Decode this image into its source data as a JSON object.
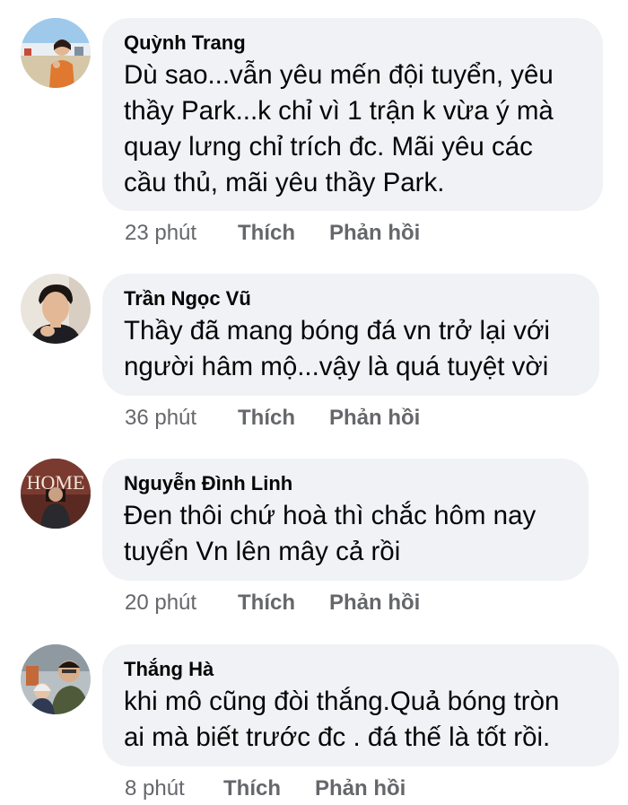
{
  "comments": [
    {
      "author": "Quỳnh Trang",
      "lines": [
        "Dù sao...vẫn yêu mến đội tuyển, yêu",
        "thầy Park...k chỉ vì 1 trận k vừa ý mà",
        "quay lưng chỉ trích đc. Mãi yêu các",
        "cầu thủ, mãi yêu thầy Park."
      ],
      "time": "23 phút",
      "like_label": "Thích",
      "reply_label": "Phản hồi"
    },
    {
      "author": "Trần Ngọc Vũ",
      "lines": [
        "Thầy đã mang bóng đá vn trở lại với",
        "người hâm mộ...vậy là quá tuyệt vời"
      ],
      "time": "36 phút",
      "like_label": "Thích",
      "reply_label": "Phản hồi"
    },
    {
      "author": "Nguyễn Đình Linh",
      "lines": [
        "Đen thôi chứ hoà thì chắc hôm nay",
        "tuyển Vn lên mây cả rồi"
      ],
      "time": "20 phút",
      "like_label": "Thích",
      "reply_label": "Phản hồi"
    },
    {
      "author": "Thắng Hà",
      "lines": [
        "khi mô cũng đòi thắng.Quả bóng tròn",
        "ai mà biết trước đc . đá thế là tốt rồi."
      ],
      "time": "8 phút",
      "like_label": "Thích",
      "reply_label": "Phản hồi"
    }
  ],
  "avatar_photos": [
    "avatar-photo-beach",
    "avatar-photo-young-man",
    "avatar-photo-home-sign",
    "avatar-photo-family"
  ],
  "avatar_sign_text": "HOME",
  "colors": {
    "bubble": "#f0f2f5",
    "text": "#050505",
    "meta": "#65676b"
  }
}
